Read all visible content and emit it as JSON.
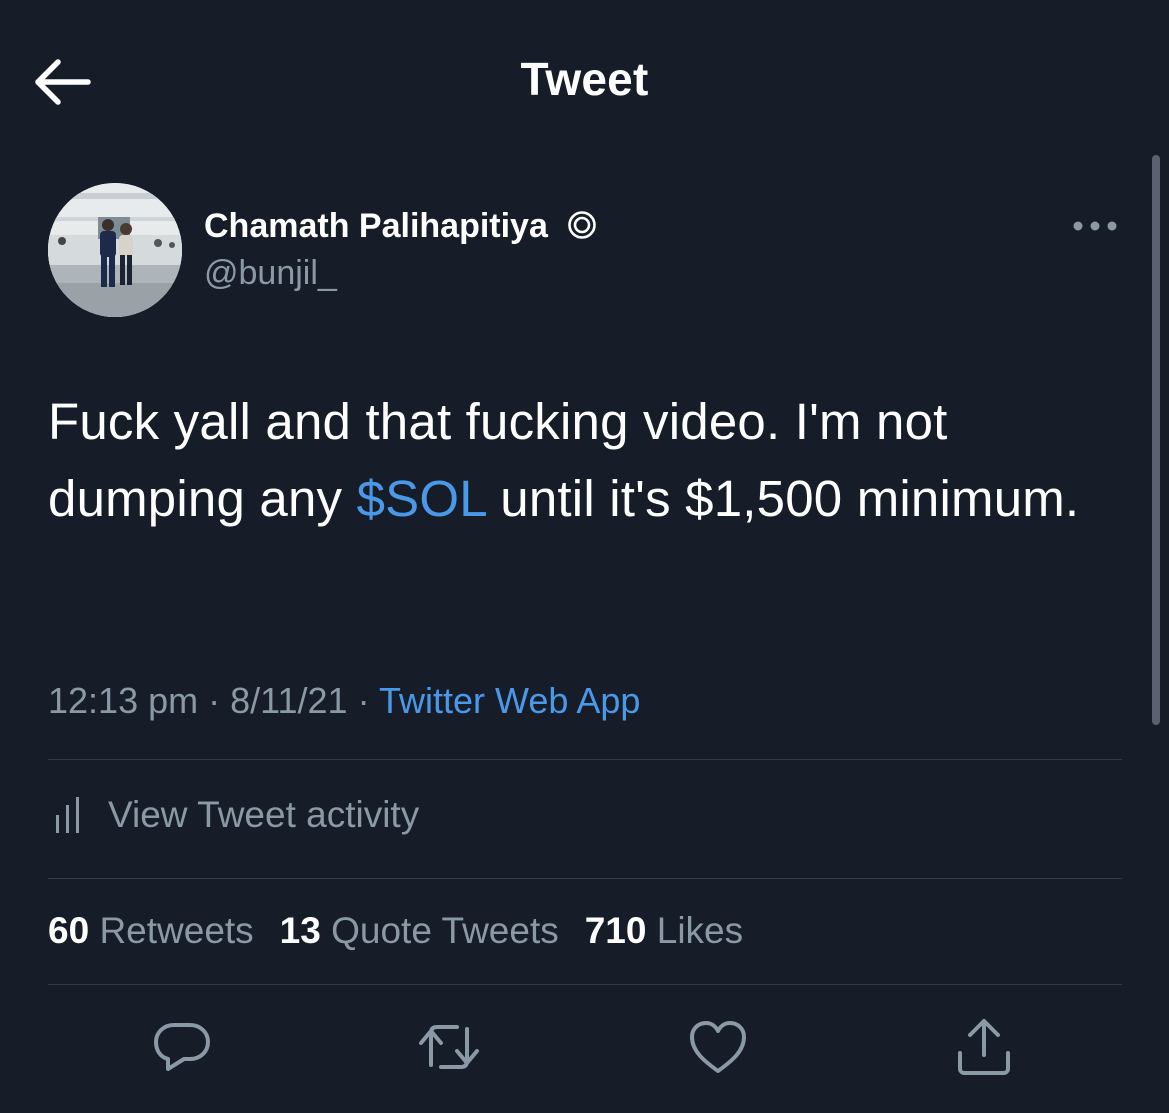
{
  "header": {
    "title": "Tweet",
    "back_icon": "arrow-left-icon"
  },
  "user": {
    "name": "Chamath Palihapitiya",
    "name_badge_icon": "circle-target-icon",
    "handle": "@bunjil_",
    "avatar_icon": "profile-photo"
  },
  "tweet": {
    "text_before": "Fuck yall and that fucking video. I'm not dumping any ",
    "cashtag": "$SOL",
    "text_after": " until it's $1,500 minimum.",
    "time": "12:13 pm",
    "separator": "·",
    "date": "8/11/21",
    "source": "Twitter Web App"
  },
  "activity": {
    "label": "View Tweet activity",
    "icon": "bar-chart-icon"
  },
  "stats": {
    "retweets_count": "60",
    "retweets_label": "Retweets",
    "quotes_count": "13",
    "quotes_label": "Quote Tweets",
    "likes_count": "710",
    "likes_label": "Likes"
  },
  "actions": [
    "reply-icon",
    "retweet-icon",
    "like-icon",
    "share-icon"
  ],
  "colors": {
    "background": "#161d29",
    "text": "#ffffff",
    "secondary_text": "#8b98a5",
    "link": "#4a99e9",
    "divider": "#323a46"
  }
}
